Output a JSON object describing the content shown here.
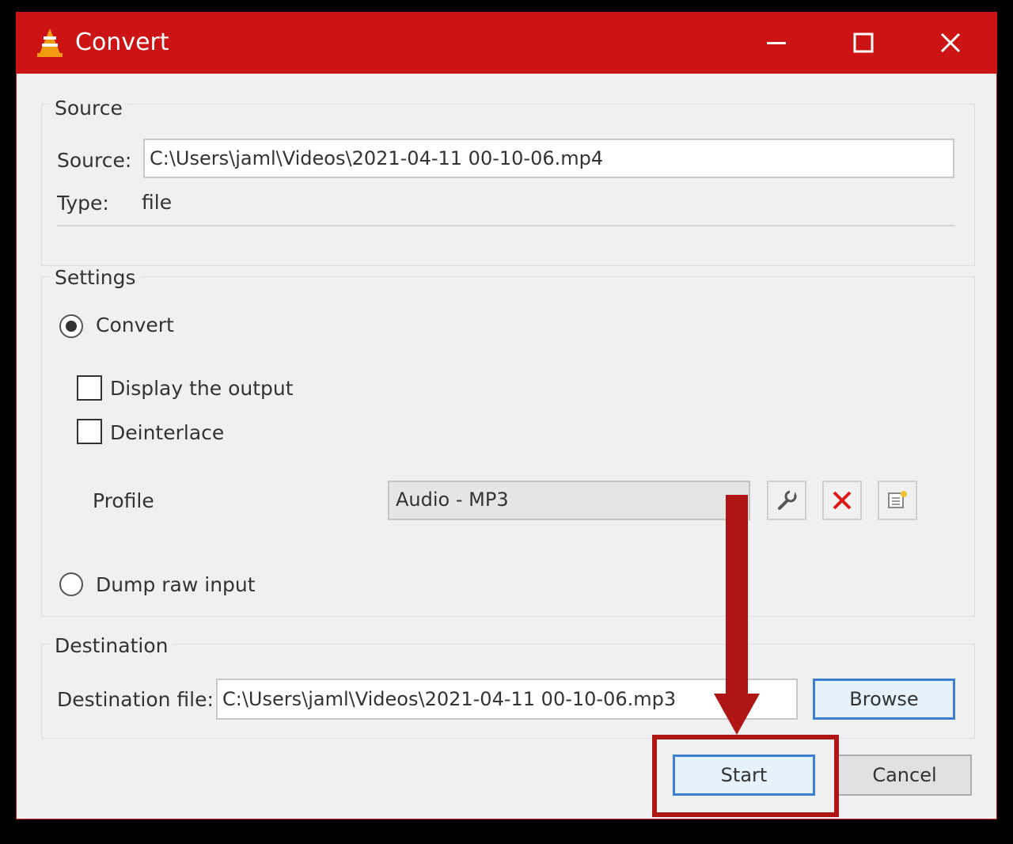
{
  "window": {
    "title": "Convert",
    "colors": {
      "titlebar": "#cc1414",
      "accent": "#3c7fd1"
    },
    "controls": [
      "minimize-icon",
      "maximize-icon",
      "close-icon"
    ]
  },
  "source": {
    "group_label": "Source",
    "source_label": "Source:",
    "source_value": "C:\\Users\\jaml\\Videos\\2021-04-11 00-10-06.mp4",
    "type_label": "Type:",
    "type_value": "file"
  },
  "settings": {
    "group_label": "Settings",
    "convert_label": "Convert",
    "convert_selected": true,
    "display_output_label": "Display the output",
    "display_output_checked": false,
    "deinterlace_label": "Deinterlace",
    "deinterlace_checked": false,
    "profile_label": "Profile",
    "profile_value": "Audio - MP3",
    "profile_buttons": [
      "wrench-icon",
      "delete-x-icon",
      "new-profile-icon"
    ],
    "dump_raw_label": "Dump raw input",
    "dump_raw_selected": false
  },
  "destination": {
    "group_label": "Destination",
    "file_label": "Destination file:",
    "file_value": "C:\\Users\\jaml\\Videos\\2021-04-11 00-10-06.mp3",
    "browse_label": "Browse"
  },
  "footer": {
    "start_label": "Start",
    "cancel_label": "Cancel"
  },
  "annotation": {
    "color": "#b01515",
    "target": "start-button"
  }
}
